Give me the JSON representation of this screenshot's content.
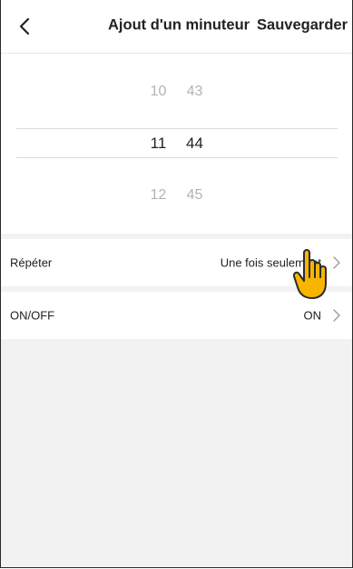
{
  "header": {
    "back_icon": "chevron-left-icon",
    "title": "Ajout d'un minuteur",
    "save_label": "Sauvegarder"
  },
  "picker": {
    "previous": {
      "hour": "10",
      "minute": "43"
    },
    "selected": {
      "hour": "11",
      "minute": "44"
    },
    "next": {
      "hour": "12",
      "minute": "45"
    }
  },
  "settings": {
    "repeat": {
      "label": "Répéter",
      "value": "Une fois seulement"
    },
    "onoff": {
      "label": "ON/OFF",
      "value": "ON"
    }
  },
  "overlay": {
    "pointer_icon": "tap-hand-icon",
    "pointer_color": "#F7B500"
  }
}
